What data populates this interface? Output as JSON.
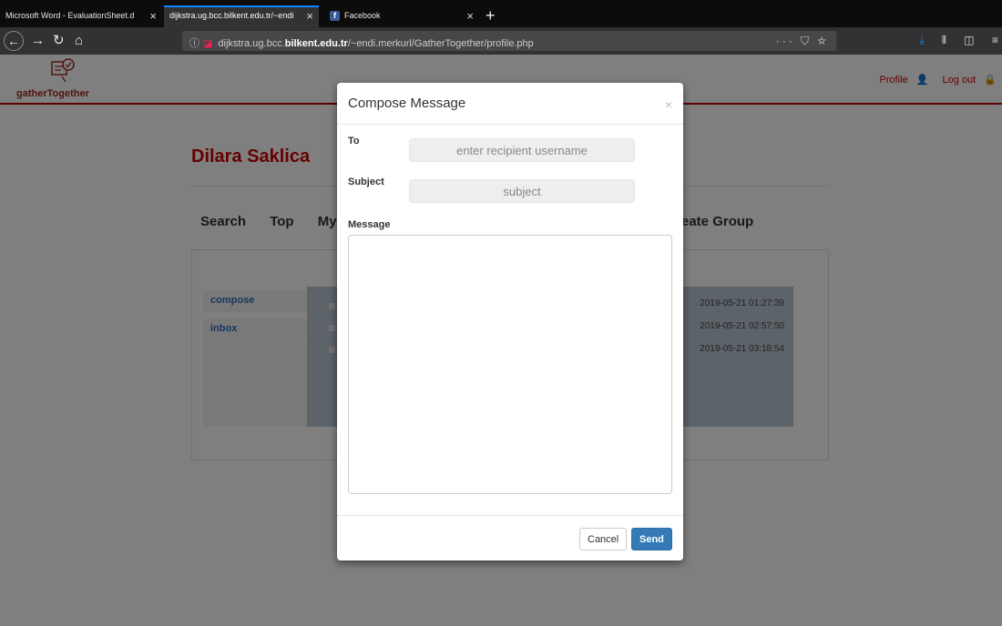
{
  "browser": {
    "tabs": [
      {
        "label": "Microsoft Word - EvaluationSheet.d",
        "active": false
      },
      {
        "label": "dijkstra.ug.bcc.bilkent.edu.tr/~endi",
        "active": true
      },
      {
        "label": "Facebook",
        "active": false
      }
    ],
    "url": {
      "prefix": "dijkstra.ug.bcc.",
      "domain": "bilkent.edu.tr",
      "path": "/~endi.merkurl/GatherTogether/profile.php"
    },
    "url_actions": "··· ⛉ ☆",
    "accent_color": "#0a84ff"
  },
  "site": {
    "logo_text": "gatherTogether",
    "profile_link": "Profile",
    "logout_link": "Log out",
    "brand_color": "#c00000"
  },
  "profile": {
    "user_name": "Dilara Saklica",
    "nav": [
      "Search",
      "Top",
      "My C"
    ],
    "nav_right": "eate Group"
  },
  "mailbox": {
    "side_items": [
      "compose",
      "inbox"
    ],
    "rows": [
      {
        "date": "2019-05-21 01:27:39"
      },
      {
        "date": "2019-05-21 02:57:50"
      },
      {
        "date": "2019-05-21 03:18:54"
      }
    ]
  },
  "modal": {
    "title": "Compose Message",
    "close": "×",
    "to_label": "To",
    "to_placeholder": "enter recipient username",
    "subject_label": "Subject",
    "subject_placeholder": "subject",
    "message_label": "Message",
    "cancel_label": "Cancel",
    "send_label": "Send"
  }
}
